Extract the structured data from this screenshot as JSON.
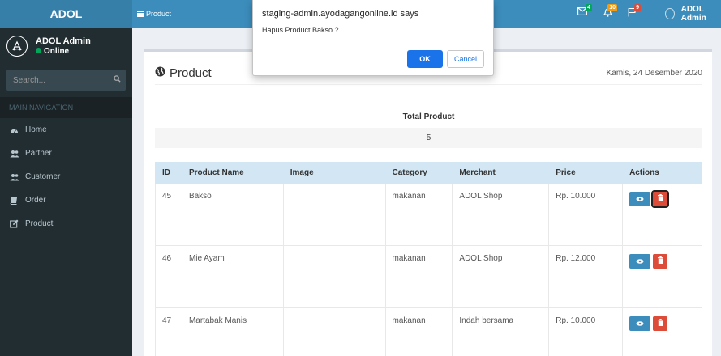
{
  "sidebar": {
    "logo": "ADOL",
    "user_name": "ADOL Admin",
    "user_status": "Online",
    "search_placeholder": "Search...",
    "nav_header": "MAIN NAVIGATION",
    "items": [
      {
        "label": "Home",
        "icon": "dashboard-icon"
      },
      {
        "label": "Partner",
        "icon": "users-icon"
      },
      {
        "label": "Customer",
        "icon": "users-icon"
      },
      {
        "label": "Order",
        "icon": "book-icon"
      },
      {
        "label": "Product",
        "icon": "edit-icon"
      }
    ]
  },
  "header": {
    "toggle_label": "Product",
    "badges": {
      "messages": "4",
      "notifications": "10",
      "tasks": "9"
    },
    "user_name": "ADOL Admin",
    "colors": {
      "msg": "#00a65a",
      "notif": "#f39c12",
      "task": "#dd4b39"
    }
  },
  "page": {
    "title": "Product",
    "date": "Kamis, 24 Desember 2020",
    "total_label": "Total Product",
    "total_value": "5"
  },
  "table": {
    "columns": [
      "ID",
      "Product Name",
      "Image",
      "Category",
      "Merchant",
      "Price",
      "Actions"
    ],
    "rows": [
      {
        "id": "45",
        "name": "Bakso",
        "image": "",
        "category": "makanan",
        "merchant": "ADOL Shop",
        "price": "Rp. 10.000"
      },
      {
        "id": "46",
        "name": "Mie Ayam",
        "image": "",
        "category": "makanan",
        "merchant": "ADOL Shop",
        "price": "Rp. 12.000"
      },
      {
        "id": "47",
        "name": "Martabak Manis",
        "image": "",
        "category": "makanan",
        "merchant": "Indah bersama",
        "price": "Rp. 10.000"
      }
    ]
  },
  "dialog": {
    "title": "staging-admin.ayodagangonline.id says",
    "message": "Hapus Product Bakso ?",
    "ok_label": "OK",
    "cancel_label": "Cancel"
  }
}
